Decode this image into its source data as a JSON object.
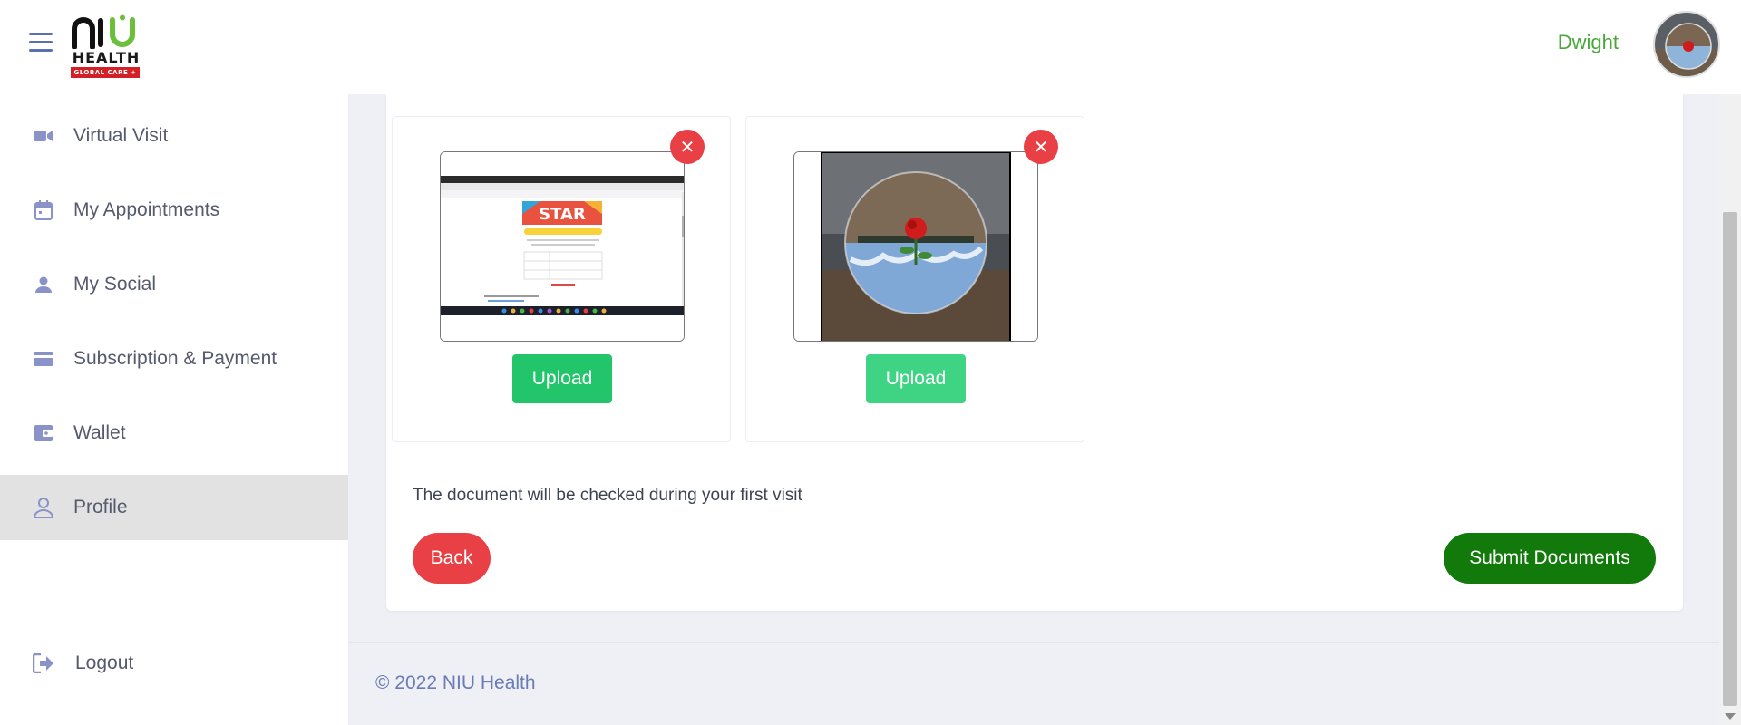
{
  "header": {
    "logo": {
      "word": "HEALTH",
      "tag": "GLOBAL CARE +"
    },
    "user_name": "Dwight"
  },
  "sidebar": {
    "items": [
      {
        "label": "Virtual Visit",
        "icon": "video-camera-icon"
      },
      {
        "label": "My Appointments",
        "icon": "calendar-icon"
      },
      {
        "label": "My Social",
        "icon": "person-icon"
      },
      {
        "label": "Subscription & Payment",
        "icon": "credit-card-icon"
      },
      {
        "label": "Wallet",
        "icon": "wallet-icon"
      },
      {
        "label": "Profile",
        "icon": "profile-icon",
        "active": true
      }
    ],
    "logout": {
      "label": "Logout",
      "icon": "logout-icon"
    }
  },
  "documents": {
    "items": [
      {
        "upload_label": "Upload",
        "remove_icon": "close-icon",
        "preview_text": "STAR"
      },
      {
        "upload_label": "Upload",
        "remove_icon": "close-icon"
      }
    ],
    "note": "The document will be checked during your first visit",
    "back_label": "Back",
    "submit_label": "Submit Documents"
  },
  "footer": {
    "copyright": "© 2022 NIU Health"
  },
  "colors": {
    "brand_green": "#4aa83b",
    "upload_green": "#22c56a",
    "danger_red": "#e84045",
    "submit_green": "#127a0a",
    "nav_icon": "#8a93c8"
  }
}
